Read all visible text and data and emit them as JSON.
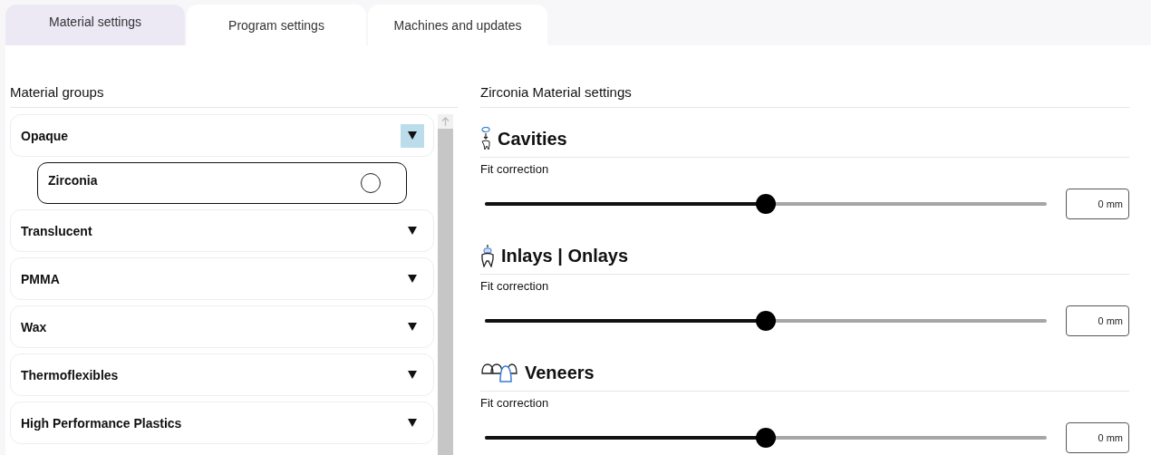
{
  "tabs": [
    {
      "label": "Material settings",
      "selected": true
    },
    {
      "label": "Program settings",
      "selected": false
    },
    {
      "label": "Machines and updates",
      "selected": false
    }
  ],
  "material_groups": {
    "title": "Material groups",
    "groups": [
      {
        "name": "Opaque",
        "expanded": true,
        "children": [
          {
            "name": "Zirconia",
            "selected": false
          }
        ]
      },
      {
        "name": "Translucent",
        "expanded": false
      },
      {
        "name": "PMMA",
        "expanded": false
      },
      {
        "name": "Wax",
        "expanded": false
      },
      {
        "name": "Thermoflexibles",
        "expanded": false
      },
      {
        "name": "High Performance Plastics",
        "expanded": false
      }
    ]
  },
  "settings": {
    "title": "Zirconia Material settings",
    "sections": [
      {
        "kind": "cavities",
        "title": "Cavities",
        "label": "Fit correction",
        "level": 0.5,
        "value": "0 mm"
      },
      {
        "kind": "inlays",
        "title": "Inlays | Onlays",
        "label": "Fit correction",
        "level": 0.5,
        "value": "0 mm"
      },
      {
        "kind": "veneers",
        "title": "Veneers",
        "label": "Fit correction",
        "level": 0.5,
        "value": "0 mm"
      }
    ]
  }
}
